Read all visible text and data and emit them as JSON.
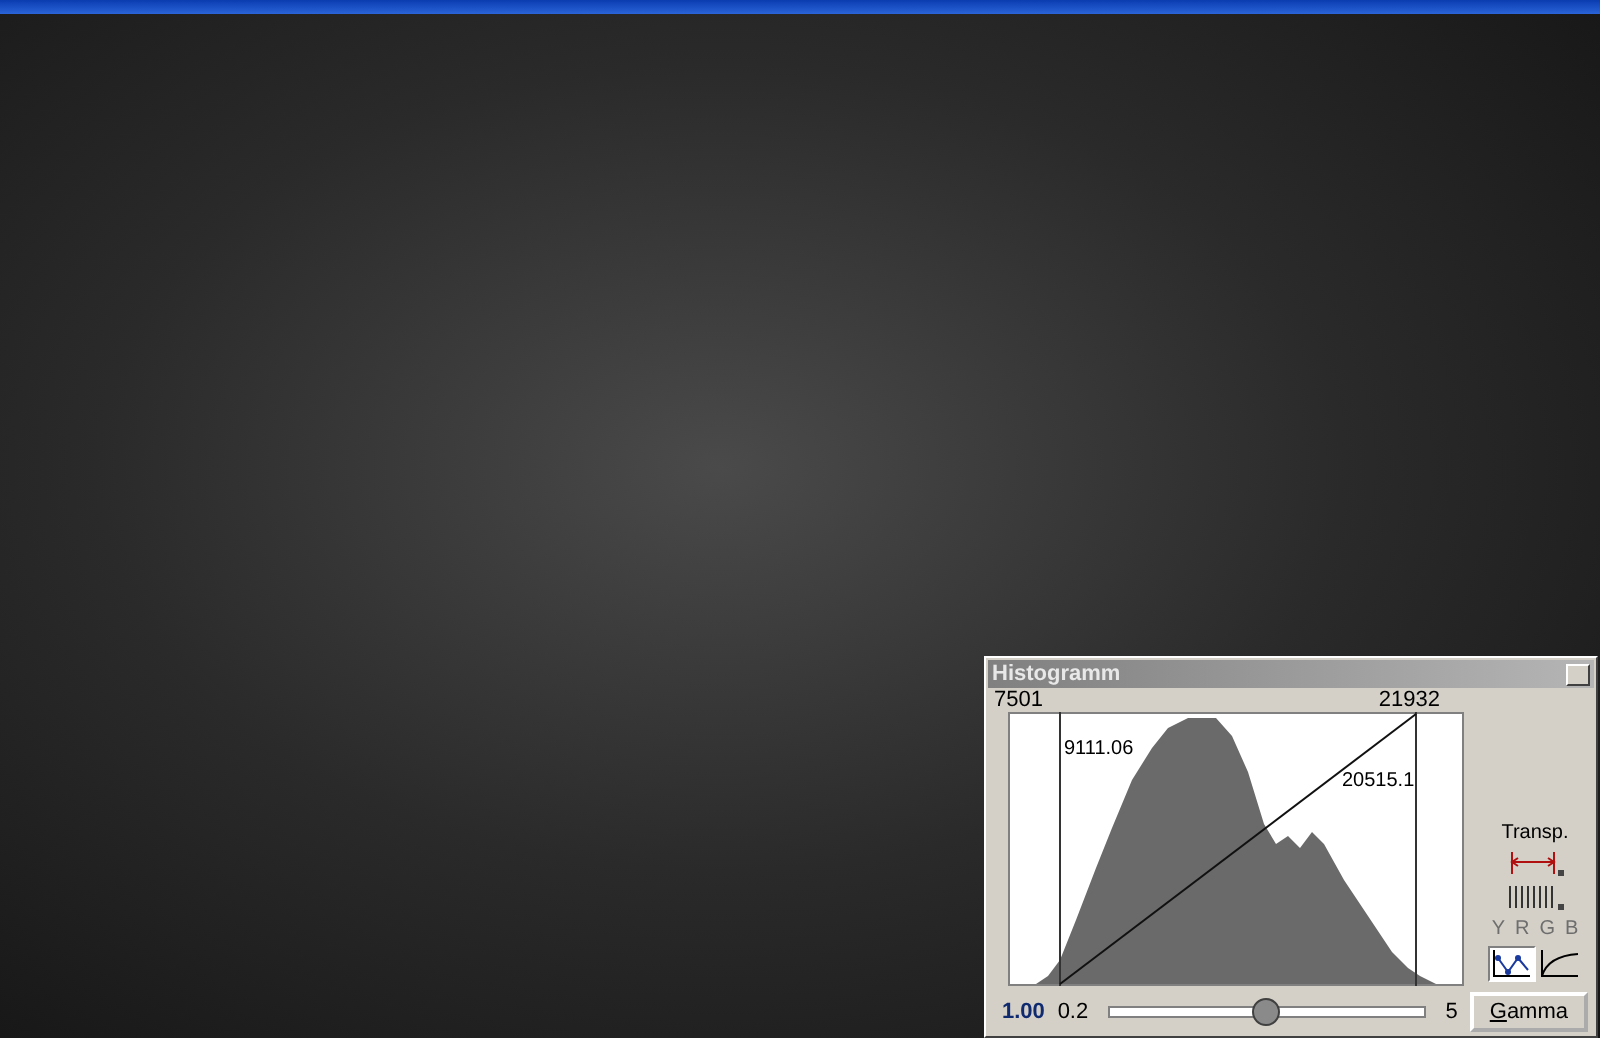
{
  "histogram": {
    "title": "Histogramm",
    "range_min": "7501",
    "range_max": "21932",
    "low_marker": "9111.06",
    "high_marker": "20515.1",
    "transp_label": "Transp.",
    "channels": [
      {
        "label": "Y",
        "disabled": true
      },
      {
        "label": "R",
        "disabled": true
      },
      {
        "label": "G",
        "disabled": true
      },
      {
        "label": "B",
        "disabled": true
      }
    ],
    "curve_modes": [
      {
        "kind": "points",
        "selected": true
      },
      {
        "kind": "gamma",
        "selected": false
      }
    ],
    "gamma_value": "1.00",
    "slider_min": "0.2",
    "slider_max": "5",
    "level": 0.5,
    "gamma_button": "Gamma"
  }
}
